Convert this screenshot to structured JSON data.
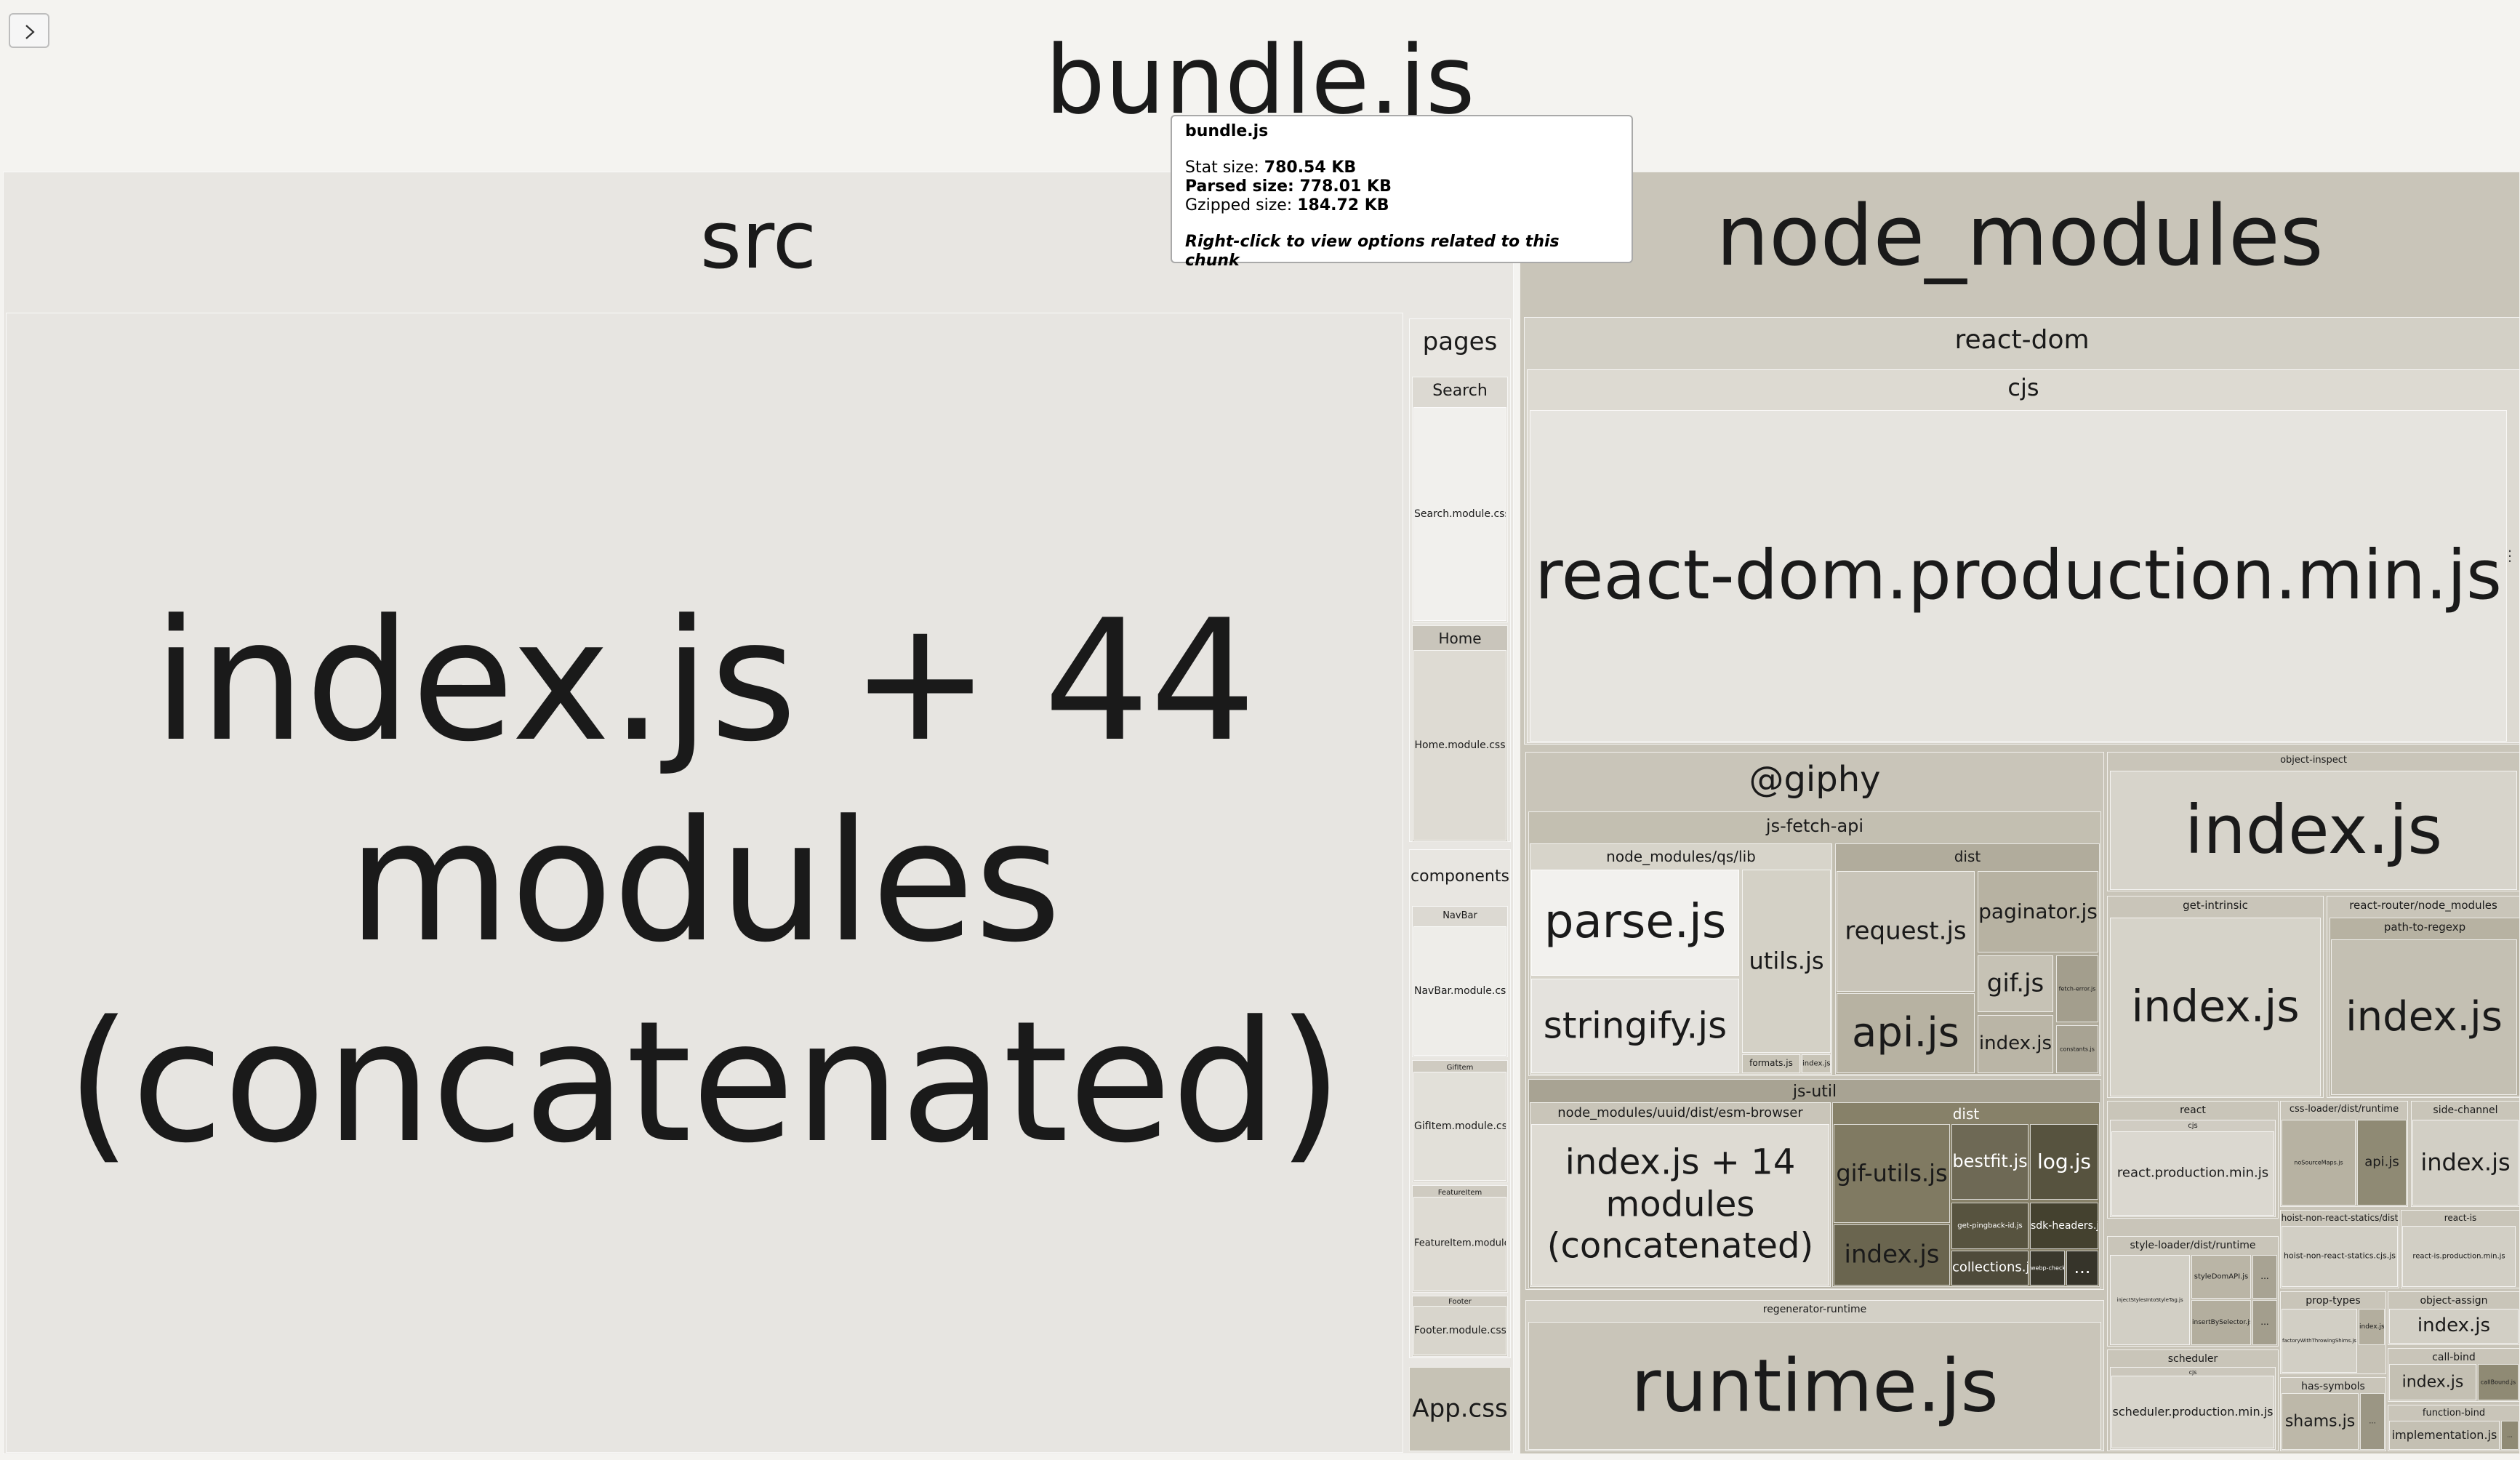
{
  "chunk": {
    "name": "bundle.js",
    "stat_size_label": "Stat size:",
    "stat_size": "780.54 KB",
    "parsed_size_label": "Parsed size:",
    "parsed_size": "778.01 KB",
    "gzipped_size_label": "Gzipped size:",
    "gzipped_size": "184.72 KB",
    "hint": "Right-click to view options related to this chunk"
  },
  "toggle_icon": "chevron-right-icon",
  "colors": {
    "page": "#f4f3f0",
    "src": "#e8e6e2",
    "node_modules": "#c9c5b9",
    "mid": "#bdb8a9",
    "dark": "#6b6650",
    "darker": "#4f4b3b",
    "darkest": "#3a382d"
  },
  "tiles": [
    {
      "id": "bundle",
      "label": "bundle.js",
      "bg": "#f4f3f0",
      "fs": 130,
      "pos": "top"
    },
    {
      "id": "src",
      "label": "src",
      "bg": "#e8e6e2",
      "fs": 110,
      "pos": "top"
    },
    {
      "id": "src-index",
      "label": "index.js + 44 modules (concatenated)",
      "bg": "#e7e5e1",
      "fs": 230,
      "pos": "center",
      "wrap": true
    },
    {
      "id": "pages",
      "label": "pages",
      "bg": "#e8e6e1",
      "fs": 34,
      "pos": "top"
    },
    {
      "id": "search",
      "label": "Search",
      "bg": "#dcd9d2",
      "fs": 22,
      "pos": "top"
    },
    {
      "id": "search-css",
      "label": "Search.module.css",
      "bg": "#f1f0ed",
      "fs": 14,
      "pos": "center"
    },
    {
      "id": "home",
      "label": "Home",
      "bg": "#c9c5bb",
      "fs": 20,
      "pos": "top"
    },
    {
      "id": "home-css",
      "label": "Home.module.css",
      "bg": "#dedbd3",
      "fs": 14,
      "pos": "center"
    },
    {
      "id": "components",
      "label": "components",
      "bg": "#e8e6e1",
      "fs": 22,
      "pos": "top"
    },
    {
      "id": "navbar",
      "label": "NavBar",
      "bg": "#dcd9d2",
      "fs": 13,
      "pos": "top"
    },
    {
      "id": "navbar-css",
      "label": "NavBar.module.css",
      "bg": "#eeede9",
      "fs": 14,
      "pos": "center"
    },
    {
      "id": "gifitem",
      "label": "GifItem",
      "bg": "#cfcbc1",
      "fs": 10,
      "pos": "top"
    },
    {
      "id": "gifitem-css",
      "label": "GifItem.module.css",
      "bg": "#e2e0d9",
      "fs": 14,
      "pos": "center"
    },
    {
      "id": "featureitem",
      "label": "FeatureItem",
      "bg": "#cfcbc1",
      "fs": 10,
      "pos": "top"
    },
    {
      "id": "featureitem-css",
      "label": "FeatureItem.module.css",
      "bg": "#dedbd3",
      "fs": 13,
      "pos": "center"
    },
    {
      "id": "footer",
      "label": "Footer",
      "bg": "#cfcbc1",
      "fs": 10,
      "pos": "top"
    },
    {
      "id": "footer-css",
      "label": "Footer.module.css",
      "bg": "#d8d5cc",
      "fs": 14,
      "pos": "center"
    },
    {
      "id": "app-css",
      "label": "App.css",
      "bg": "#c6c2b5",
      "fs": 34,
      "pos": "center"
    },
    {
      "id": "node_modules",
      "label": "node_modules",
      "bg": "#c9c5b9",
      "fs": 115,
      "pos": "top"
    },
    {
      "id": "react-dom",
      "label": "react-dom",
      "bg": "#d3d0c6",
      "fs": 36,
      "pos": "top"
    },
    {
      "id": "cjs",
      "label": "cjs",
      "bg": "#dddad2",
      "fs": 32,
      "pos": "top"
    },
    {
      "id": "react-dom-prod",
      "label": "react-dom.production.min.js",
      "bg": "#e6e4df",
      "fs": 94,
      "pos": "center"
    },
    {
      "id": "giphy",
      "label": "@giphy",
      "bg": "#c9c5b9",
      "fs": 48,
      "pos": "top"
    },
    {
      "id": "js-fetch-api",
      "label": "js-fetch-api",
      "bg": "#c3bfb1",
      "fs": 24,
      "pos": "top"
    },
    {
      "id": "qs-lib",
      "label": "node_modules/qs/lib",
      "bg": "#d7d4ca",
      "fs": 20,
      "pos": "top"
    },
    {
      "id": "parse",
      "label": "parse.js",
      "bg": "#f2f1ee",
      "fs": 64,
      "pos": "center"
    },
    {
      "id": "stringify",
      "label": "stringify.js",
      "bg": "#e4e2dd",
      "fs": 50,
      "pos": "center"
    },
    {
      "id": "utils",
      "label": "utils.js",
      "bg": "#d4d1c6",
      "fs": 32,
      "pos": "center"
    },
    {
      "id": "formats",
      "label": "formats.js",
      "bg": "#c8c4b7",
      "fs": 12,
      "pos": "center"
    },
    {
      "id": "qs-index",
      "label": "index.js",
      "bg": "#c8c4b7",
      "fs": 10,
      "pos": "center"
    },
    {
      "id": "dist1",
      "label": "dist",
      "bg": "#b1ac9c",
      "fs": 20,
      "pos": "top"
    },
    {
      "id": "request",
      "label": "request.js",
      "bg": "#c9c5b9",
      "fs": 34,
      "pos": "center"
    },
    {
      "id": "api",
      "label": "api.js",
      "bg": "#b7b2a2",
      "fs": 56,
      "pos": "center"
    },
    {
      "id": "paginator",
      "label": "paginator.js",
      "bg": "#b7b2a2",
      "fs": 28,
      "pos": "center"
    },
    {
      "id": "gif",
      "label": "gif.js",
      "bg": "#c6c2b5",
      "fs": 34,
      "pos": "center"
    },
    {
      "id": "fetch-error",
      "label": "fetch-error.js",
      "bg": "#a39e8d",
      "fs": 8,
      "pos": "center"
    },
    {
      "id": "dist1-index",
      "label": "index.js",
      "bg": "#bab5a6",
      "fs": 26,
      "pos": "center"
    },
    {
      "id": "constants",
      "label": "constants.js",
      "bg": "#a8a393",
      "fs": 8,
      "pos": "center"
    },
    {
      "id": "js-util",
      "label": "js-util",
      "bg": "#a8a393",
      "fs": 22,
      "pos": "top"
    },
    {
      "id": "uuid",
      "label": "node_modules/uuid/dist/esm-browser",
      "bg": "#c9c5b9",
      "fs": 18,
      "pos": "top"
    },
    {
      "id": "uuid-index",
      "label": "index.js + 14 modules (concatenated)",
      "bg": "#dedbd3",
      "fs": 48,
      "pos": "center",
      "wrap": true
    },
    {
      "id": "dist2",
      "label": "dist",
      "bg": "#878169",
      "fs": 20,
      "pos": "top",
      "color": "#ffffff"
    },
    {
      "id": "gif-utils",
      "label": "gif-utils.js",
      "bg": "#807a62",
      "fs": 32,
      "pos": "center"
    },
    {
      "id": "bestfit",
      "label": "bestfit.js",
      "bg": "#6e6955",
      "fs": 24,
      "pos": "center",
      "color": "#ffffff"
    },
    {
      "id": "log",
      "label": "log.js",
      "bg": "#57533f",
      "fs": 28,
      "pos": "center",
      "color": "#ffffff"
    },
    {
      "id": "dist2-index",
      "label": "index.js",
      "bg": "#6a654f",
      "fs": 34,
      "pos": "center"
    },
    {
      "id": "pingback",
      "label": "get-pingback-id.js",
      "bg": "#57533f",
      "fs": 10,
      "pos": "center",
      "color": "#ffffff"
    },
    {
      "id": "sdk-headers",
      "label": "sdk-headers.js",
      "bg": "#44412f",
      "fs": 14,
      "pos": "center",
      "color": "#ffffff"
    },
    {
      "id": "collections",
      "label": "collections.js",
      "bg": "#4f4b3b",
      "fs": 18,
      "pos": "center",
      "color": "#ffffff"
    },
    {
      "id": "webp-check",
      "label": "webp-check.js",
      "bg": "#3a382d",
      "fs": 8,
      "pos": "center",
      "color": "#ffffff"
    },
    {
      "id": "dist2-more",
      "label": "...",
      "bg": "#36342a",
      "fs": 24,
      "pos": "center",
      "color": "#ffffff"
    },
    {
      "id": "regenerator",
      "label": "regenerator-runtime",
      "bg": "#d3d0c6",
      "fs": 14,
      "pos": "top"
    },
    {
      "id": "runtime",
      "label": "runtime.js",
      "bg": "#c9c5b9",
      "fs": 100,
      "pos": "center"
    },
    {
      "id": "object-inspect",
      "label": "object-inspect",
      "bg": "#c9c5b9",
      "fs": 13,
      "pos": "top"
    },
    {
      "id": "oi-index",
      "label": "index.js",
      "bg": "#d7d4cb",
      "fs": 92,
      "pos": "center"
    },
    {
      "id": "get-intrinsic",
      "label": "get-intrinsic",
      "bg": "#c9c5b9",
      "fs": 15,
      "pos": "top"
    },
    {
      "id": "gi-index",
      "label": "index.js",
      "bg": "#d6d3c9",
      "fs": 60,
      "pos": "center"
    },
    {
      "id": "rr-nm",
      "label": "react-router/node_modules",
      "bg": "#c9c5b9",
      "fs": 15,
      "pos": "top"
    },
    {
      "id": "path-to-regexp",
      "label": "path-to-regexp",
      "bg": "#b7b2a2",
      "fs": 15,
      "pos": "top"
    },
    {
      "id": "ptr-index",
      "label": "index.js",
      "bg": "#c4c0b3",
      "fs": 56,
      "pos": "center"
    },
    {
      "id": "react",
      "label": "react",
      "bg": "#c9c5b9",
      "fs": 14,
      "pos": "top"
    },
    {
      "id": "react-cjs",
      "label": "cjs",
      "bg": "#d0ccc2",
      "fs": 10,
      "pos": "top"
    },
    {
      "id": "react-prod",
      "label": "react.production.min.js",
      "bg": "#dbd8d0",
      "fs": 18,
      "pos": "center"
    },
    {
      "id": "css-loader",
      "label": "css-loader/dist/runtime",
      "bg": "#c9c5b9",
      "fs": 13,
      "pos": "top"
    },
    {
      "id": "no-source-maps",
      "label": "noSourceMaps.js",
      "bg": "#b7b2a2",
      "fs": 8,
      "pos": "center"
    },
    {
      "id": "css-api",
      "label": "api.js",
      "bg": "#8f8a74",
      "fs": 18,
      "pos": "center"
    },
    {
      "id": "side-channel",
      "label": "side-channel",
      "bg": "#c9c5b9",
      "fs": 14,
      "pos": "top"
    },
    {
      "id": "sc-index",
      "label": "index.js",
      "bg": "#d2cfc5",
      "fs": 32,
      "pos": "center"
    },
    {
      "id": "hnrs",
      "label": "hoist-non-react-statics/dist",
      "bg": "#c9c5b9",
      "fs": 12,
      "pos": "top"
    },
    {
      "id": "hnrs-file",
      "label": "hoist-non-react-statics.cjs.js",
      "bg": "#d2cfc5",
      "fs": 11,
      "pos": "center"
    },
    {
      "id": "react-is",
      "label": "react-is",
      "bg": "#c9c5b9",
      "fs": 12,
      "pos": "top"
    },
    {
      "id": "react-is-prod",
      "label": "react-is.production.min.js",
      "bg": "#d2cfc5",
      "fs": 10,
      "pos": "center"
    },
    {
      "id": "style-loader",
      "label": "style-loader/dist/runtime",
      "bg": "#c9c5b9",
      "fs": 14,
      "pos": "top"
    },
    {
      "id": "inject-styles",
      "label": "injectStylesIntoStyleTag.js",
      "bg": "#d2cfc5",
      "fs": 7,
      "pos": "center"
    },
    {
      "id": "style-dom-api",
      "label": "styleDomAPI.js",
      "bg": "#bab5a6",
      "fs": 10,
      "pos": "center"
    },
    {
      "id": "insert-by-selector",
      "label": "insertBySelector.js",
      "bg": "#b3ae9e",
      "fs": 9,
      "pos": "center"
    },
    {
      "id": "sl-more1",
      "label": "...",
      "bg": "#a8a393",
      "fs": 12,
      "pos": "center"
    },
    {
      "id": "sl-more2",
      "label": "...",
      "bg": "#a39e8d",
      "fs": 12,
      "pos": "center"
    },
    {
      "id": "prop-types",
      "label": "prop-types",
      "bg": "#c9c5b9",
      "fs": 14,
      "pos": "top"
    },
    {
      "id": "fpt",
      "label": "factoryWithThrowingShims.js",
      "bg": "#d2cfc5",
      "fs": 7,
      "pos": "center"
    },
    {
      "id": "pt-index",
      "label": "index.js",
      "bg": "#b3ae9e",
      "fs": 9,
      "pos": "center"
    },
    {
      "id": "object-assign",
      "label": "object-assign",
      "bg": "#c9c5b9",
      "fs": 14,
      "pos": "top"
    },
    {
      "id": "oa-index",
      "label": "index.js",
      "bg": "#d2cfc5",
      "fs": 26,
      "pos": "center"
    },
    {
      "id": "scheduler",
      "label": "scheduler",
      "bg": "#c9c5b9",
      "fs": 14,
      "pos": "top"
    },
    {
      "id": "sched-cjs",
      "label": "cjs",
      "bg": "#cbc7bc",
      "fs": 8,
      "pos": "top"
    },
    {
      "id": "sched-prod",
      "label": "scheduler.production.min.js",
      "bg": "#d7d4cb",
      "fs": 16,
      "pos": "center"
    },
    {
      "id": "has-symbols",
      "label": "has-symbols",
      "bg": "#c9c5b9",
      "fs": 14,
      "pos": "top"
    },
    {
      "id": "shams",
      "label": "shams.js",
      "bg": "#bdb8a9",
      "fs": 22,
      "pos": "center"
    },
    {
      "id": "hs-more",
      "label": "...",
      "bg": "#9b9684",
      "fs": 10,
      "pos": "center"
    },
    {
      "id": "call-bind",
      "label": "call-bind",
      "bg": "#c9c5b9",
      "fs": 14,
      "pos": "top"
    },
    {
      "id": "cb-index",
      "label": "index.js",
      "bg": "#c4c0b3",
      "fs": 22,
      "pos": "center"
    },
    {
      "id": "callbound",
      "label": "callBound.js",
      "bg": "#8f8a74",
      "fs": 8,
      "pos": "center"
    },
    {
      "id": "function-bind",
      "label": "function-bind",
      "bg": "#c9c5b9",
      "fs": 13,
      "pos": "top"
    },
    {
      "id": "fb-impl",
      "label": "implementation.js",
      "bg": "#c4c0b3",
      "fs": 16,
      "pos": "center"
    },
    {
      "id": "fb-more",
      "label": "...",
      "bg": "#8f8a74",
      "fs": 8,
      "pos": "center"
    }
  ]
}
